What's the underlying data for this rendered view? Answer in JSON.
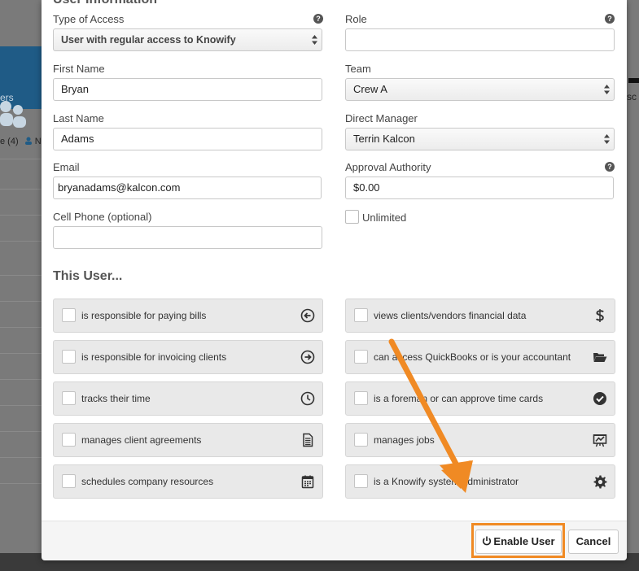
{
  "background": {
    "tile_label": "ers",
    "tab_text": "e (4)",
    "tab_text2": "N",
    "right_text": "sc"
  },
  "modal": {
    "section_title": "User Information",
    "fields": {
      "type_of_access": {
        "label": "Type of Access",
        "value": "User with regular access to Knowify"
      },
      "role": {
        "label": "Role",
        "value": ""
      },
      "first_name": {
        "label": "First Name",
        "value": "Bryan"
      },
      "team": {
        "label": "Team",
        "value": "Crew A"
      },
      "last_name": {
        "label": "Last Name",
        "value": "Adams"
      },
      "direct_manager": {
        "label": "Direct Manager",
        "value": "Terrin Kalcon"
      },
      "email": {
        "label": "Email",
        "value": "bryanadams@kalcon.com"
      },
      "approval_authority": {
        "label": "Approval Authority",
        "value": "$0.00"
      },
      "cell_phone": {
        "label": "Cell Phone (optional)",
        "value": ""
      }
    },
    "unlimited_label": "Unlimited",
    "help_glyph": "?",
    "this_user_title": "This User...",
    "roles_left": [
      {
        "label": "is responsible for paying bills",
        "icon": "arrow-circle-left-icon"
      },
      {
        "label": "is responsible for invoicing clients",
        "icon": "arrow-circle-right-icon"
      },
      {
        "label": "tracks their time",
        "icon": "clock-icon"
      },
      {
        "label": "manages client agreements",
        "icon": "document-icon"
      },
      {
        "label": "schedules company resources",
        "icon": "calendar-icon"
      }
    ],
    "roles_right": [
      {
        "label": "views clients/vendors financial data",
        "icon": "dollar-icon"
      },
      {
        "label": "can access QuickBooks or is your accountant",
        "icon": "folder-open-icon"
      },
      {
        "label": "is a foreman or can approve time cards",
        "icon": "check-circle-icon"
      },
      {
        "label": "manages jobs",
        "icon": "chart-board-icon"
      },
      {
        "label": "is a Knowify system administrator",
        "icon": "gear-icon"
      }
    ],
    "footer": {
      "enable_label": "Enable User",
      "cancel_label": "Cancel"
    }
  },
  "colors": {
    "highlight": "#f08a24",
    "brand_blue": "#1f5b86"
  }
}
